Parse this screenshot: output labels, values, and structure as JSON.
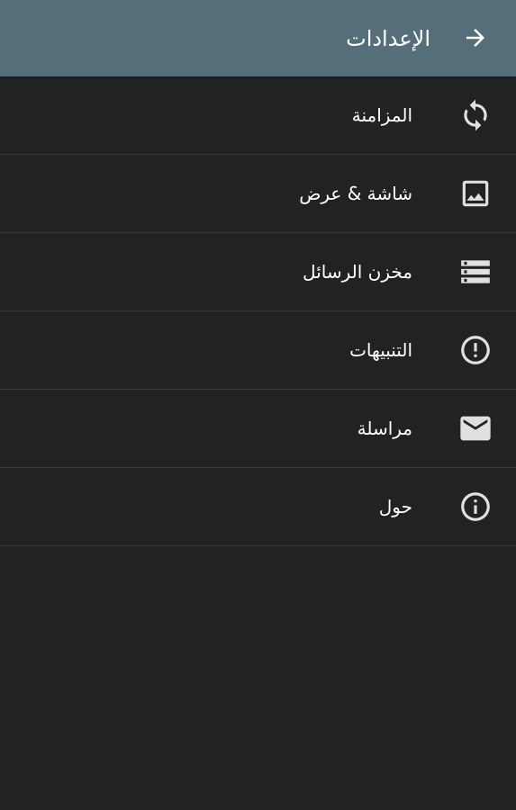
{
  "header": {
    "title": "الإعدادات",
    "back_icon": "arrow-right-icon"
  },
  "colors": {
    "app_bar": "#546e7a",
    "background": "#222222",
    "divider": "#3a3a3a",
    "text": "#ffffff",
    "icon": "#e0e0e0"
  },
  "menu": {
    "items": [
      {
        "label": "المزامنة",
        "icon": "sync-icon"
      },
      {
        "label": "شاشة & عرض",
        "icon": "image-icon"
      },
      {
        "label": "مخزن الرسائل",
        "icon": "storage-icon"
      },
      {
        "label": "التنبيهات",
        "icon": "alert-icon"
      },
      {
        "label": "مراسلة",
        "icon": "email-icon"
      },
      {
        "label": "حول",
        "icon": "info-icon"
      }
    ]
  }
}
